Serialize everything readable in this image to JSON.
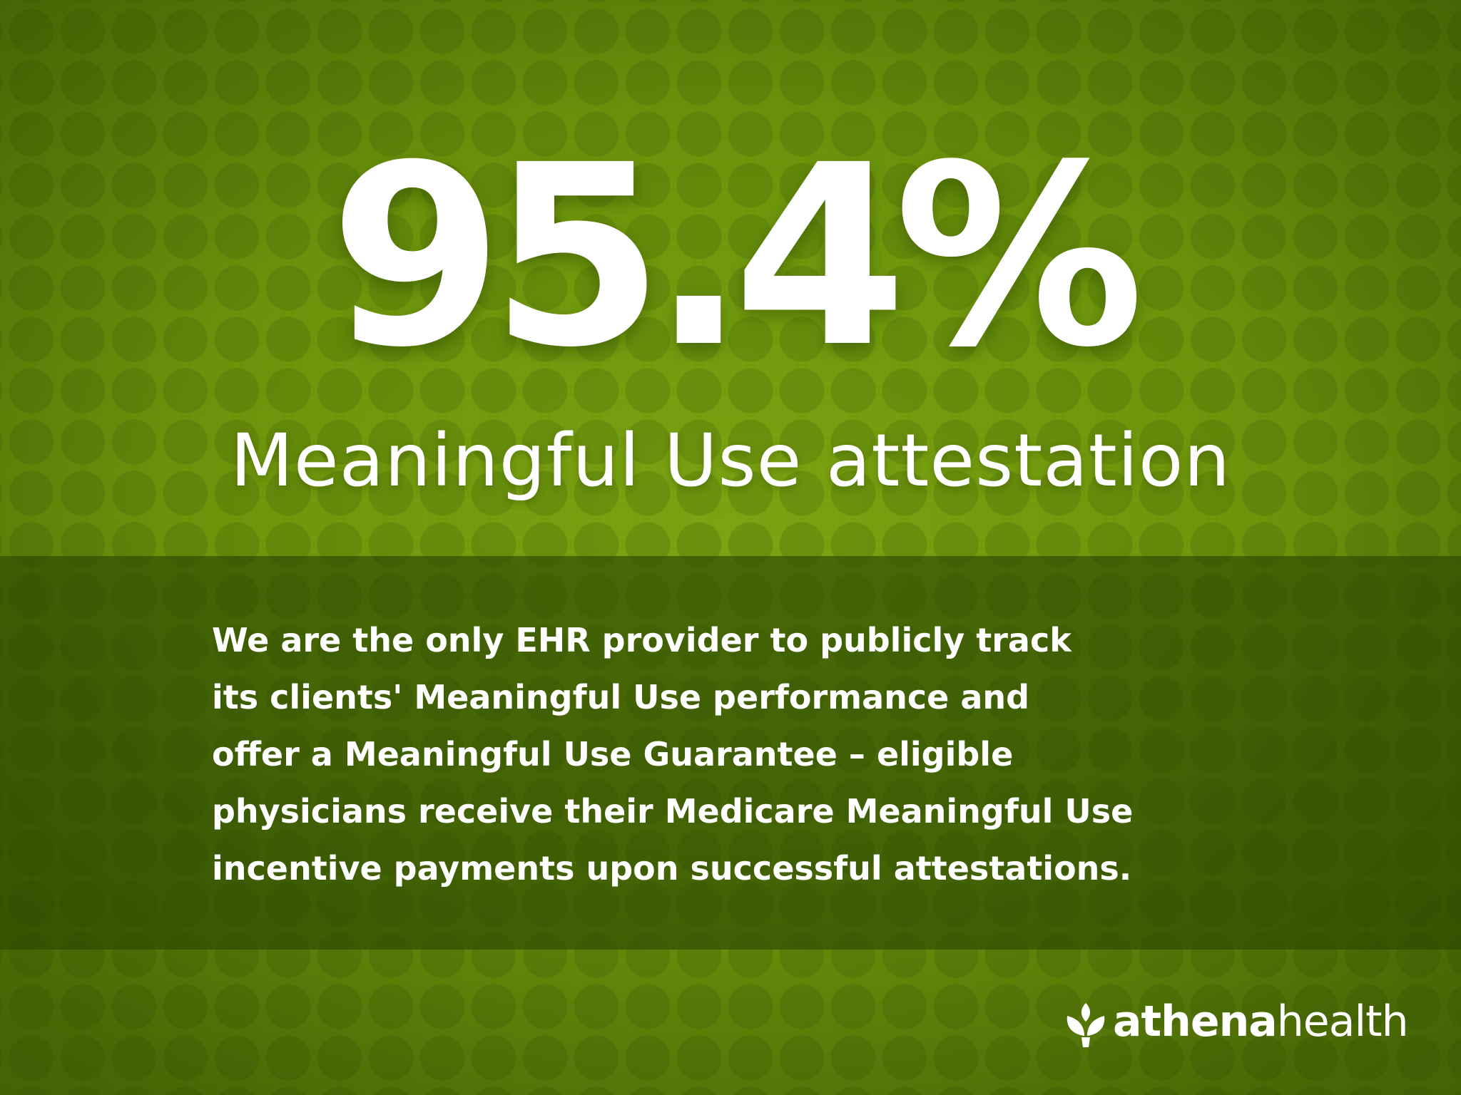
{
  "headline": {
    "stat": "95.4%",
    "subtitle": "Meaningful Use attestation"
  },
  "body": {
    "lines": [
      "We are the only EHR provider to publicly track",
      "its clients' Meaningful Use performance and",
      "offer a Meaningful Use Guarantee – eligible",
      "physicians receive their Medicare Meaningful Use",
      "incentive payments upon successful attestations."
    ]
  },
  "logo": {
    "part1": "athena",
    "part2": "health",
    "icon": "leaf-sprout-icon"
  },
  "colors": {
    "background": "#73990e",
    "band": "#3e5c06",
    "text": "#ffffff"
  }
}
